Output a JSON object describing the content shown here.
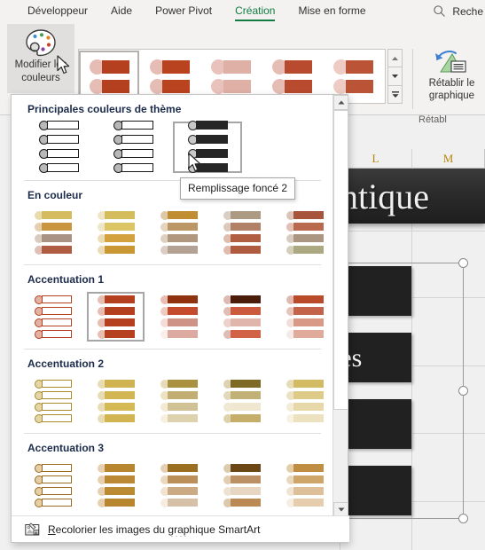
{
  "ribbon": {
    "tabs": [
      {
        "label": "Développeur",
        "active": false
      },
      {
        "label": "Aide",
        "active": false
      },
      {
        "label": "Power Pivot",
        "active": false
      },
      {
        "label": "Création",
        "active": true
      },
      {
        "label": "Mise en forme",
        "active": false
      }
    ],
    "search": {
      "label": "Reche",
      "icon": "search-icon"
    },
    "change_colors_button": {
      "label_line1": "Modifier les",
      "label_line2": "couleurs",
      "icon": "palette-icon",
      "palette_dots": [
        "#3f8fd0",
        "#3fa24a",
        "#e8821e",
        "#d03f2a",
        "#8b3fa8"
      ]
    },
    "reset_button": {
      "label_line1": "Rétablir le",
      "label_line2": "graphique",
      "icon": "reset-graphic-icon"
    },
    "group_caption": "Rétabl",
    "gallery_items": [
      {
        "name": "style-1",
        "circle": "#e6bdb5",
        "rect": "#b5401f",
        "selected": true
      },
      {
        "name": "style-2",
        "circle": "#e6bdb5",
        "rect": "#b9421f",
        "selected": false
      },
      {
        "name": "style-3",
        "circle": "#e8c2bb",
        "rect": "#dfb0a6",
        "selected": false
      },
      {
        "name": "style-4",
        "circle": "#e6bdb5",
        "rect": "#b84a2e",
        "selected": false
      },
      {
        "name": "style-5",
        "circle": "#eecbc4",
        "rect": "#bb5337",
        "selected": false
      }
    ],
    "gallery_scroll": {
      "up": "scroll-up-icon",
      "down": "scroll-down-icon",
      "more": "more-styles-icon"
    }
  },
  "dropdown": {
    "tooltip": "Remplissage foncé 2",
    "footer": {
      "label": "Recolorier les images du graphique SmartArt",
      "icon": "recolor-picture-icon",
      "accesskey": "R"
    },
    "scrollbar": {
      "up": "scroll-up-icon",
      "down": "scroll-down-icon"
    },
    "sections": [
      {
        "title": "Principales couleurs de thème",
        "style": "theme",
        "items": [
          {
            "name": "remplissage-clair-1",
            "selected": false,
            "lines": [
              {
                "circle": "#b8b8b8",
                "bar": "#ffffff",
                "bar_border": "#1a1a1a"
              },
              {
                "circle": "#b8b8b8",
                "bar": "#ffffff",
                "bar_border": "#1a1a1a"
              },
              {
                "circle": "#b8b8b8",
                "bar": "#ffffff",
                "bar_border": "#1a1a1a"
              },
              {
                "circle": "#b8b8b8",
                "bar": "#ffffff",
                "bar_border": "#1a1a1a"
              }
            ]
          },
          {
            "name": "remplissage-clair-2",
            "selected": false,
            "lines": [
              {
                "circle": "#b8b8b8",
                "bar": "#ffffff",
                "bar_border": "#1a1a1a"
              },
              {
                "circle": "#b8b8b8",
                "bar": "#ffffff",
                "bar_border": "#1a1a1a"
              },
              {
                "circle": "#b8b8b8",
                "bar": "#ffffff",
                "bar_border": "#1a1a1a"
              },
              {
                "circle": "#b8b8b8",
                "bar": "#ffffff",
                "bar_border": "#1a1a1a"
              }
            ]
          },
          {
            "name": "remplissage-fonce-2",
            "selected": true,
            "lines": [
              {
                "circle": "#c9c9c9",
                "bar": "#262626",
                "bar_border": "#262626"
              },
              {
                "circle": "#c9c9c9",
                "bar": "#262626",
                "bar_border": "#262626"
              },
              {
                "circle": "#c9c9c9",
                "bar": "#262626",
                "bar_border": "#262626"
              },
              {
                "circle": "#c9c9c9",
                "bar": "#262626",
                "bar_border": "#262626"
              }
            ]
          }
        ]
      },
      {
        "title": "En couleur",
        "style": "bars",
        "items": [
          {
            "name": "en-couleur-1",
            "selected": false,
            "lines": [
              {
                "circle": "#e8dcae",
                "bar": "#d4bc5e"
              },
              {
                "circle": "#e6cfae",
                "bar": "#c9953f"
              },
              {
                "circle": "#d9cbbd",
                "bar": "#a99183"
              },
              {
                "circle": "#dec0b6",
                "bar": "#b05c43"
              }
            ]
          },
          {
            "name": "en-couleur-2",
            "selected": false,
            "lines": [
              {
                "circle": "#efe6c8",
                "bar": "#d3bc5c"
              },
              {
                "circle": "#efe6c8",
                "bar": "#dbc564"
              },
              {
                "circle": "#ecdcb6",
                "bar": "#d3a23e"
              },
              {
                "circle": "#ecdcb6",
                "bar": "#ca9735"
              }
            ]
          },
          {
            "name": "en-couleur-3",
            "selected": false,
            "lines": [
              {
                "circle": "#ddc9a8",
                "bar": "#c08d33"
              },
              {
                "circle": "#e4d4c0",
                "bar": "#bc9665"
              },
              {
                "circle": "#ded0c0",
                "bar": "#b1977e"
              },
              {
                "circle": "#dacec4",
                "bar": "#b3a193"
              }
            ]
          },
          {
            "name": "en-couleur-4",
            "selected": false,
            "lines": [
              {
                "circle": "#d9cfc4",
                "bar": "#ad9a82"
              },
              {
                "circle": "#dcc9bd",
                "bar": "#b08166"
              },
              {
                "circle": "#dfbcae",
                "bar": "#b05f43"
              },
              {
                "circle": "#dfbcae",
                "bar": "#ae5b40"
              }
            ]
          },
          {
            "name": "en-couleur-5",
            "selected": false,
            "lines": [
              {
                "circle": "#dcc4bb",
                "bar": "#a6543c"
              },
              {
                "circle": "#e2bfb3",
                "bar": "#b96a4e"
              },
              {
                "circle": "#d8cdc0",
                "bar": "#ab9681"
              },
              {
                "circle": "#d4cfba",
                "bar": "#aba882"
              }
            ]
          }
        ]
      },
      {
        "title": "Accentuation 1",
        "style": "bars",
        "items": [
          {
            "name": "accent1-contour-seulement",
            "selected": false,
            "lines": [
              {
                "circle": "#e2b3a4",
                "bar": "#ffffff",
                "bar_border": "#b5401f"
              },
              {
                "circle": "#e2b3a4",
                "bar": "#ffffff",
                "bar_border": "#b5401f"
              },
              {
                "circle": "#e2b3a4",
                "bar": "#ffffff",
                "bar_border": "#b5401f"
              },
              {
                "circle": "#e2b3a4",
                "bar": "#ffffff",
                "bar_border": "#b5401f"
              }
            ]
          },
          {
            "name": "accent1-remplissage-couleur",
            "selected": true,
            "lines": [
              {
                "circle": "#e8bdb2",
                "bar": "#b5401f"
              },
              {
                "circle": "#e8bdb2",
                "bar": "#b5401f"
              },
              {
                "circle": "#e8bdb2",
                "bar": "#b5401f"
              },
              {
                "circle": "#e8bdb2",
                "bar": "#b5401f"
              }
            ]
          },
          {
            "name": "accent1-degrade-boucle",
            "selected": false,
            "lines": [
              {
                "circle": "#e8bdb2",
                "bar": "#91320f"
              },
              {
                "circle": "#efcbc1",
                "bar": "#c44b2c"
              },
              {
                "circle": "#f4ddd7",
                "bar": "#cf9287"
              },
              {
                "circle": "#faeeeb",
                "bar": "#dcaaa0"
              }
            ]
          },
          {
            "name": "accent1-plage-degrade",
            "selected": false,
            "lines": [
              {
                "circle": "#ddbbb2",
                "bar": "#4a1d0b"
              },
              {
                "circle": "#e2bdb3",
                "bar": "#cb5a3d"
              },
              {
                "circle": "#ecd2cb",
                "bar": "#e0b5ab"
              },
              {
                "circle": "#dfbdb4",
                "bar": "#d16248"
              }
            ]
          },
          {
            "name": "accent1-transparent",
            "selected": false,
            "lines": [
              {
                "circle": "#e0bab0",
                "bar": "#b94b2a"
              },
              {
                "circle": "#e6c4ba",
                "bar": "#c3634a"
              },
              {
                "circle": "#f1ded9",
                "bar": "#d99987"
              },
              {
                "circle": "#f6eae6",
                "bar": "#e0ab9a"
              }
            ]
          }
        ]
      },
      {
        "title": "Accentuation 2",
        "style": "bars",
        "items": [
          {
            "name": "accent2-contour-seulement",
            "selected": false,
            "lines": [
              {
                "circle": "#e4d6ab",
                "bar": "#ffffff",
                "bar_border": "#a98b2c"
              },
              {
                "circle": "#e4d6ab",
                "bar": "#ffffff",
                "bar_border": "#a98b2c"
              },
              {
                "circle": "#e4d6ab",
                "bar": "#ffffff",
                "bar_border": "#a98b2c"
              },
              {
                "circle": "#e4d6ab",
                "bar": "#ffffff",
                "bar_border": "#a98b2c"
              }
            ]
          },
          {
            "name": "accent2-remplissage-couleur",
            "selected": false,
            "lines": [
              {
                "circle": "#e8dcb4",
                "bar": "#ceb350"
              },
              {
                "circle": "#e8dcb4",
                "bar": "#d2b654"
              },
              {
                "circle": "#e8dcb4",
                "bar": "#d4b954"
              },
              {
                "circle": "#e8dcb4",
                "bar": "#d2b450"
              }
            ]
          },
          {
            "name": "accent2-degrade-boucle",
            "selected": false,
            "lines": [
              {
                "circle": "#e6dcb8",
                "bar": "#a9913f"
              },
              {
                "circle": "#ece3c4",
                "bar": "#c2ae72"
              },
              {
                "circle": "#f2ead4",
                "bar": "#d0c295"
              },
              {
                "circle": "#f7f0e2",
                "bar": "#ddd2ad"
              }
            ]
          },
          {
            "name": "accent2-plage-degrade",
            "selected": false,
            "lines": [
              {
                "circle": "#ddd3b0",
                "bar": "#7d6a24"
              },
              {
                "circle": "#e2d8bb",
                "bar": "#c2b177"
              },
              {
                "circle": "#efe8d4",
                "bar": "#efe7cf"
              },
              {
                "circle": "#ded2ae",
                "bar": "#c4ae6a"
              }
            ]
          },
          {
            "name": "accent2-transparent",
            "selected": false,
            "lines": [
              {
                "circle": "#e6dcb6",
                "bar": "#d2bb63"
              },
              {
                "circle": "#ebe2c4",
                "bar": "#ddcb87"
              },
              {
                "circle": "#f2ebd6",
                "bar": "#e6d8a8"
              },
              {
                "circle": "#f7f2e4",
                "bar": "#ece2bf"
              }
            ]
          }
        ]
      },
      {
        "title": "Accentuation 3",
        "style": "bars",
        "items": [
          {
            "name": "accent3-contour-seulement",
            "selected": false,
            "lines": [
              {
                "circle": "#e4cfa8",
                "bar": "#ffffff",
                "bar_border": "#9a6a1e"
              },
              {
                "circle": "#e4cfa8",
                "bar": "#ffffff",
                "bar_border": "#9a6a1e"
              },
              {
                "circle": "#e4cfa8",
                "bar": "#ffffff",
                "bar_border": "#9a6a1e"
              },
              {
                "circle": "#e4cfa8",
                "bar": "#ffffff",
                "bar_border": "#9a6a1e"
              }
            ]
          },
          {
            "name": "accent3-remplissage-couleur",
            "selected": false,
            "lines": [
              {
                "circle": "#e6d0b0",
                "bar": "#b8862f"
              },
              {
                "circle": "#e6d0b0",
                "bar": "#bb8934"
              },
              {
                "circle": "#e6d0b0",
                "bar": "#bb8b34"
              },
              {
                "circle": "#e6d0b0",
                "bar": "#b8862f"
              }
            ]
          },
          {
            "name": "accent3-degrade-boucle",
            "selected": false,
            "lines": [
              {
                "circle": "#e4d0b2",
                "bar": "#9a6f22"
              },
              {
                "circle": "#ead9c0",
                "bar": "#bb9058"
              },
              {
                "circle": "#f0e3d2",
                "bar": "#ccab84"
              },
              {
                "circle": "#f6ece1",
                "bar": "#d6c0a8"
              }
            ]
          },
          {
            "name": "accent3-plage-degrade",
            "selected": false,
            "lines": [
              {
                "circle": "#ddcbaf",
                "bar": "#6a4714"
              },
              {
                "circle": "#e0cdb2",
                "bar": "#bb9064"
              },
              {
                "circle": "#eee3d3",
                "bar": "#e6d6c2"
              },
              {
                "circle": "#ddc8ab",
                "bar": "#bb8953"
              }
            ]
          },
          {
            "name": "accent3-transparent",
            "selected": false,
            "lines": [
              {
                "circle": "#e4ceaa",
                "bar": "#c08e42"
              },
              {
                "circle": "#e9d8bd",
                "bar": "#cea66a"
              },
              {
                "circle": "#f0e4d2",
                "bar": "#ddbf99"
              },
              {
                "circle": "#f6eee2",
                "bar": "#e5cdae"
              }
            ]
          }
        ]
      }
    ]
  },
  "worksheet": {
    "column_headers": [
      "L",
      "M"
    ],
    "smartart": {
      "title_text": "ntique",
      "box_texts": [
        "ntes",
        "",
        ""
      ]
    }
  }
}
